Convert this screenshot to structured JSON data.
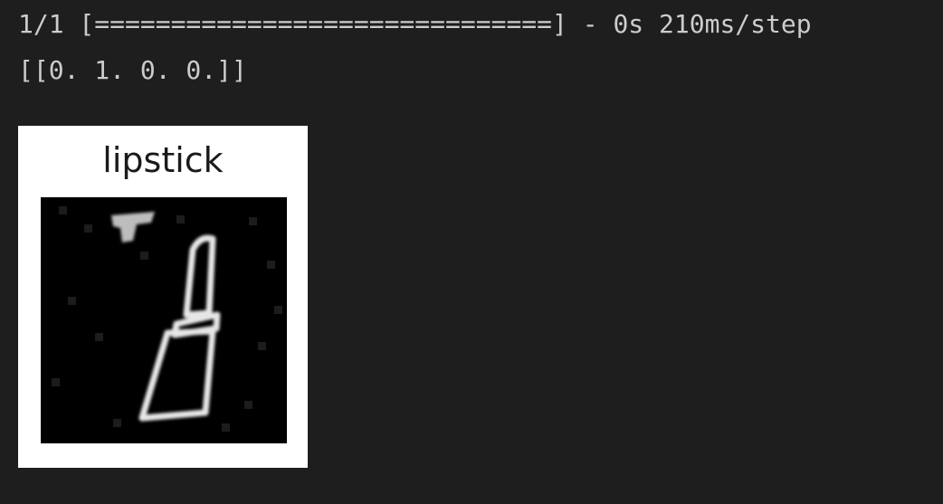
{
  "output": {
    "progress_line": "1/1 [==============================] - 0s 210ms/step",
    "prediction_line": "[[0. 1. 0. 0.]]"
  },
  "figure": {
    "title": "lipstick",
    "image_subject": "lipstick-sketch-icon"
  },
  "colors": {
    "background": "#1e1e1e",
    "text": "#cccccc",
    "figure_background": "#ffffff",
    "plot_background": "#000000",
    "stroke": "#e6e6e6"
  }
}
